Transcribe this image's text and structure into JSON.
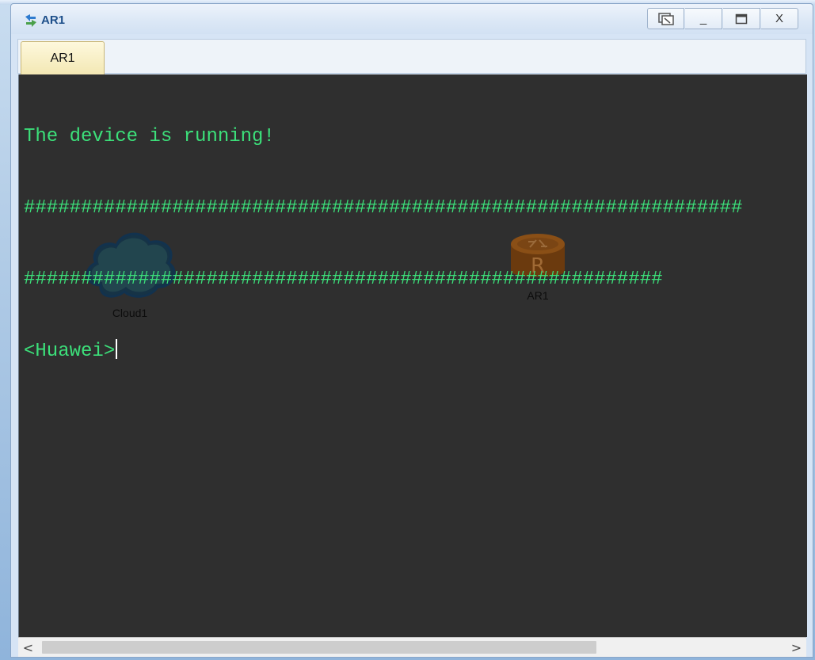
{
  "window": {
    "title": "AR1",
    "controls": {
      "restore": "restore-icon",
      "minimize": "_",
      "maximize": "maximize-icon",
      "close": "X"
    }
  },
  "tabs": [
    {
      "label": "AR1",
      "active": true
    }
  ],
  "console": {
    "lines": [
      "The device is running!",
      "###############################################################",
      "########################################################",
      "<Huawei>"
    ],
    "text_color": "#3ce07a",
    "background": "#2f2f2f"
  },
  "topology": {
    "nodes": [
      {
        "label": "Cloud1",
        "icon": "cloud-icon"
      },
      {
        "label": "AR1",
        "icon": "router-icon"
      }
    ]
  },
  "scrollbar": {
    "left_arrow": "<",
    "right_arrow": ">"
  }
}
